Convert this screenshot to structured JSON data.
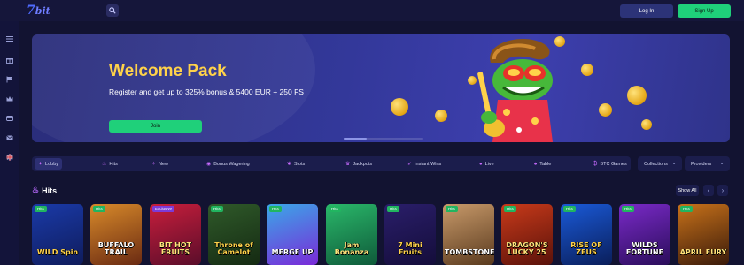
{
  "header": {
    "logo_text": "7bit",
    "login_label": "Log In",
    "signup_label": "Sign Up",
    "search_icon": "search-icon"
  },
  "sidebar": {
    "icons": [
      "gift-icon",
      "promo-flag-icon",
      "crown-icon",
      "tournament-icon",
      "mail-icon",
      "language-flag-icon"
    ]
  },
  "banner": {
    "title": "Welcome Pack",
    "subtitle": "Register and get up to 325% bonus & 5400 EUR + 250 FS",
    "join_label": "Join"
  },
  "categories": [
    {
      "label": "Lobby",
      "icon": "lobby-icon",
      "active": true
    },
    {
      "label": "Hits",
      "icon": "flame-icon",
      "active": false
    },
    {
      "label": "New",
      "icon": "new-icon",
      "active": false
    },
    {
      "label": "Bonus Wagering",
      "icon": "bonus-icon",
      "active": false
    },
    {
      "label": "Slots",
      "icon": "cherry-icon",
      "active": false
    },
    {
      "label": "Jackpots",
      "icon": "jackpot-icon",
      "active": false
    },
    {
      "label": "Instant Wins",
      "icon": "rocket-icon",
      "active": false
    },
    {
      "label": "Live",
      "icon": "live-icon",
      "active": false
    },
    {
      "label": "Table",
      "icon": "cards-icon",
      "active": false
    },
    {
      "label": "BTC Games",
      "icon": "bitcoin-icon",
      "active": false
    }
  ],
  "filters": {
    "collections_label": "Collections",
    "providers_label": "Providers"
  },
  "hits": {
    "title": "Hits",
    "show_all_label": "Show All",
    "games": [
      {
        "badge": "Hits",
        "title": "WILD Spin",
        "colors": [
          "#1a3aa8",
          "#0f1c5c"
        ]
      },
      {
        "badge": "Hits",
        "title": "BUFFALO TRAIL",
        "colors": [
          "#d88a2a",
          "#6a2a12"
        ]
      },
      {
        "badge": "Exclusive",
        "title": "BIT HOT FRUITS",
        "colors": [
          "#c81e3c",
          "#5a0d2a"
        ]
      },
      {
        "badge": "Hits",
        "title": "Throne of Camelot",
        "colors": [
          "#2f5a2a",
          "#152a12"
        ]
      },
      {
        "badge": "Hits",
        "title": "MERGE UP",
        "colors": [
          "#3aa8e8",
          "#7a2ad8"
        ]
      },
      {
        "badge": "Hits",
        "title": "Jam Bonanza",
        "colors": [
          "#2ab86a",
          "#0f5a3a"
        ]
      },
      {
        "badge": "Hits",
        "title": "7 Mini Fruits",
        "colors": [
          "#2a1e6a",
          "#140d3a"
        ]
      },
      {
        "badge": "Hits",
        "title": "TOMBSTONE",
        "colors": [
          "#c89a6a",
          "#5a3a1e"
        ]
      },
      {
        "badge": "Hits",
        "title": "DRAGON'S LUCKY 25",
        "colors": [
          "#c83a1a",
          "#5a120a"
        ]
      },
      {
        "badge": "Hits",
        "title": "RISE OF ZEUS",
        "colors": [
          "#1a5ad8",
          "#0a1e5a"
        ]
      },
      {
        "badge": "Hits",
        "title": "WILDS FORTUNE",
        "colors": [
          "#7a2ac8",
          "#2a0d5a"
        ]
      },
      {
        "badge": "Hits",
        "title": "APRIL FURY",
        "colors": [
          "#c8721a",
          "#3a1a0a"
        ]
      }
    ]
  }
}
